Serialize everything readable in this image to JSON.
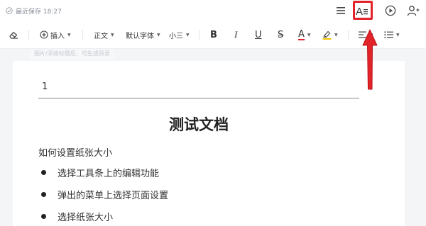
{
  "header": {
    "save_status": "最近保存 18:27",
    "icons": [
      "menu-icon",
      "text-format-icon",
      "play-icon",
      "add-user-icon"
    ]
  },
  "toolbar": {
    "clear_format_icon": "eraser-icon",
    "insert_label": "插入",
    "style_label": "正文",
    "font_label": "默认字体",
    "size_label": "小三",
    "bold_label": "B",
    "italic_label": "I",
    "underline_label": "U",
    "strike_label": "S",
    "font_color_label": "A",
    "font_color": "#e2242a",
    "highlight_color": "#f5c400",
    "align_icon": "align-left-icon",
    "list_icon": "bullet-list-icon"
  },
  "outline_tip": "图片/添加标题后，可生成目录",
  "document": {
    "field_value": "1",
    "title": "测试文档",
    "paragraph": "如何设置纸张大小",
    "bullets": [
      "选择工具条上的编辑功能",
      "弹出的菜单上选择页面设置",
      "选择纸张大小"
    ]
  },
  "annotation": {
    "highlight_color": "#e2242a",
    "arrow_color": "#e2242a"
  }
}
